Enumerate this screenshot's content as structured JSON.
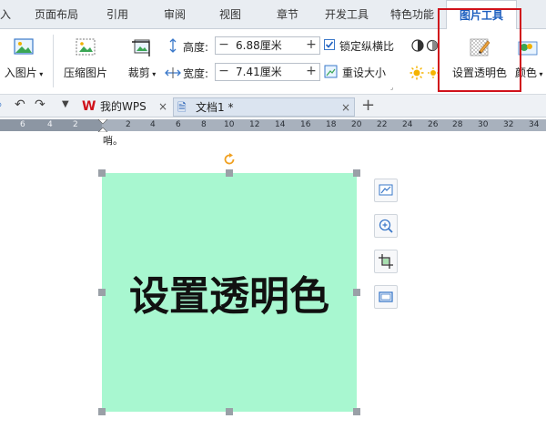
{
  "tabs": [
    "入",
    "页面布局",
    "引用",
    "审阅",
    "视图",
    "章节",
    "开发工具",
    "特色功能",
    "图片工具"
  ],
  "ribbon": {
    "insert_picture": "入图片",
    "compress_picture": "压缩图片",
    "crop": "裁剪",
    "height_label": "高度:",
    "height_value": "6.88厘米",
    "width_label": "宽度:",
    "width_value": "7.41厘米",
    "lock_ratio": "锁定纵横比",
    "reset_size": "重设大小",
    "set_transparent": "设置透明色",
    "color": "颜色",
    "minus": "−",
    "plus": "+"
  },
  "doc_tabs": {
    "wps": "我的WPS",
    "doc": "文档1 *",
    "close": "×",
    "new": "+"
  },
  "ruler": [
    "6",
    "4",
    "2",
    "2",
    "4",
    "6",
    "8",
    "10",
    "12",
    "14",
    "16",
    "18",
    "20",
    "22",
    "24",
    "26",
    "28",
    "30",
    "32",
    "34"
  ],
  "doc_text_fragment": "哨。",
  "picture_text": "设置透明色",
  "colors": {
    "accent_tab": "#1d5fbf",
    "highlight_border": "#d0121b",
    "picture_fill": "#a8f7d0"
  }
}
